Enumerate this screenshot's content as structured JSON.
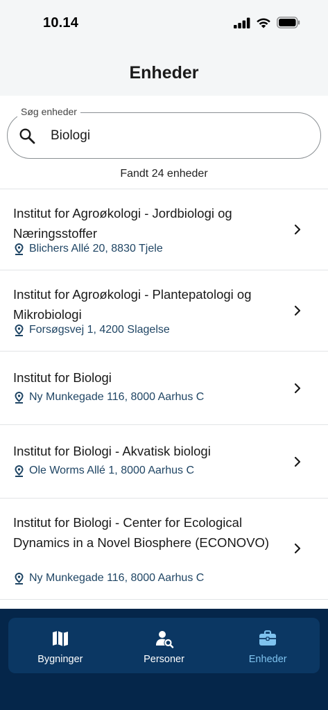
{
  "status_bar": {
    "time": "10.14"
  },
  "header": {
    "title": "Enheder"
  },
  "search": {
    "legend": "Søg enheder",
    "value": "Biologi"
  },
  "results": {
    "count_text": "Fandt 24 enheder"
  },
  "units": [
    {
      "title": "Institut for Agroøkologi - Jordbiologi og Næringsstoffer",
      "address": "Blichers Allé 20, 8830 Tjele"
    },
    {
      "title": "Institut for Agroøkologi - Plantepatologi og Mikrobiologi",
      "address": "Forsøgsvej 1, 4200 Slagelse"
    },
    {
      "title": "Institut for Biologi",
      "address": "Ny Munkegade 116, 8000 Aarhus C"
    },
    {
      "title": "Institut for Biologi - Akvatisk biologi",
      "address": "Ole Worms Allé 1, 8000 Aarhus C"
    },
    {
      "title": "Institut for Biologi - Center for Ecological Dynamics in a Novel Biosphere (ECONOVO)",
      "address": "Ny Munkegade 116, 8000 Aarhus C"
    }
  ],
  "tabbar": {
    "tabs": [
      {
        "label": "Bygninger",
        "icon": "map-icon"
      },
      {
        "label": "Personer",
        "icon": "person-search-icon"
      },
      {
        "label": "Enheder",
        "icon": "briefcase-icon"
      }
    ],
    "active_index": 2
  },
  "colors": {
    "accent": "#1f4564",
    "tab_active": "#7fc3ef",
    "tab_inactive": "#ffffff",
    "nav_bg": "#0b3763",
    "nav_outer": "#05264a"
  }
}
